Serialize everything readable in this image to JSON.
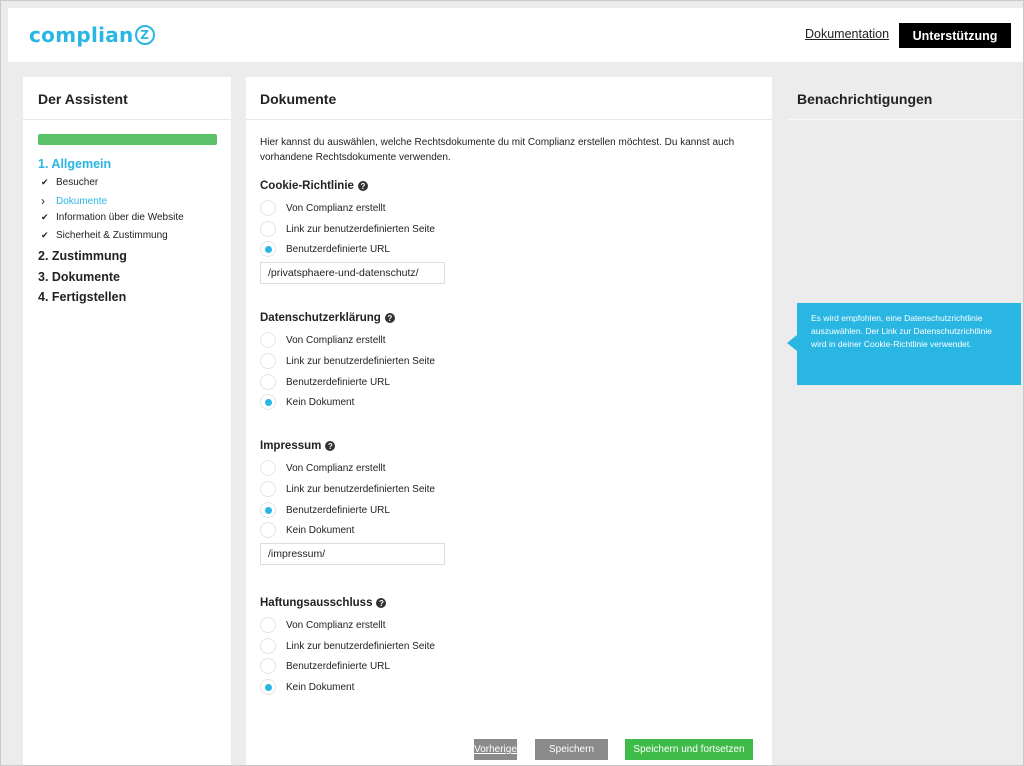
{
  "header": {
    "logo_text": "complian",
    "logo_letter": "Z",
    "doc_link": "Dokumentation",
    "support_button": "Unterstützung"
  },
  "wizard": {
    "title": "Der Assistent",
    "progress_percent": 100,
    "steps": [
      {
        "label": "1. Allgemein",
        "active": true
      },
      {
        "label": "2. Zustimmung",
        "active": false
      },
      {
        "label": "3. Dokumente",
        "active": false
      },
      {
        "label": "4. Fertigstellen",
        "active": false
      }
    ],
    "substeps": [
      {
        "label": "Besucher",
        "state": "done"
      },
      {
        "label": "Dokumente",
        "state": "current"
      },
      {
        "label": "Information über die Website",
        "state": "done"
      },
      {
        "label": "Sicherheit & Zustimmung",
        "state": "done"
      }
    ]
  },
  "main": {
    "title": "Dokumente",
    "intro": "Hier kannst du auswählen, welche Rechtsdokumente du mit Complianz erstellen möchtest. Du kannst auch vorhandene Rechtsdokumente verwenden.",
    "sections": [
      {
        "title": "Cookie-Richtlinie",
        "options": [
          "Von Complianz erstellt",
          "Link zur benutzerdefinierten Seite",
          "Benutzerdefinierte URL"
        ],
        "selected": 2,
        "url_value": "/privatsphaere-und-datenschutz/"
      },
      {
        "title": "Datenschutzerklärung",
        "options": [
          "Von Complianz erstellt",
          "Link zur benutzerdefinierten Seite",
          "Benutzerdefinierte URL",
          "Kein Dokument"
        ],
        "selected": 3
      },
      {
        "title": "Impressum",
        "options": [
          "Von Complianz erstellt",
          "Link zur benutzerdefinierten Seite",
          "Benutzerdefinierte URL",
          "Kein Dokument"
        ],
        "selected": 2,
        "url_value": "/impressum/"
      },
      {
        "title": "Haftungsausschluss",
        "options": [
          "Von Complianz erstellt",
          "Link zur benutzerdefinierten Seite",
          "Benutzerdefinierte URL",
          "Kein Dokument"
        ],
        "selected": 3
      }
    ],
    "buttons": {
      "previous": "Vorherige",
      "save": "Speichern",
      "save_continue": "Speichern und fortsetzen"
    }
  },
  "notifications": {
    "title": "Benachrichtigungen",
    "tooltip": "Es wird empfohlen, eine Datenschutzrichtlinie auszuwählen. Der Link zur Datenschutzrichtlinie wird in deiner Cookie-Richtlinie verwendet."
  },
  "colors": {
    "accent": "#29b6e3",
    "progress": "#5cc26a",
    "primary_button": "#3fbb4a",
    "secondary_button": "#8a8a8a"
  }
}
